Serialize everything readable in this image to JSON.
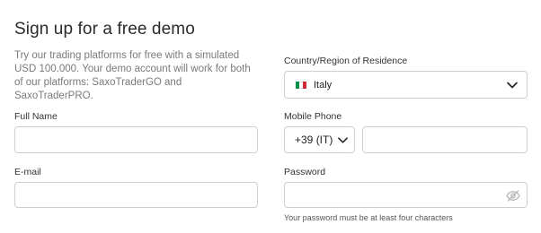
{
  "form": {
    "title": "Sign up for a free demo",
    "intro": "Try our trading platforms for free with a simulated USD 100.000. Your demo account will work for both of our platforms: SaxoTraderGO and SaxoTraderPRO.",
    "country": {
      "label": "Country/Region of Residence",
      "selected": "Italy",
      "flag_colors": [
        "#009246",
        "#ffffff",
        "#ce2b37"
      ],
      "icon": "chevron-down-icon"
    },
    "full_name": {
      "label": "Full Name",
      "value": ""
    },
    "mobile_phone": {
      "label": "Mobile Phone",
      "country_code": "+39 (IT)",
      "number": ""
    },
    "email": {
      "label": "E-mail",
      "value": ""
    },
    "password": {
      "label": "Password",
      "value": "",
      "hint": "Your password must be at least four characters",
      "icon": "eye-slash-icon"
    }
  }
}
